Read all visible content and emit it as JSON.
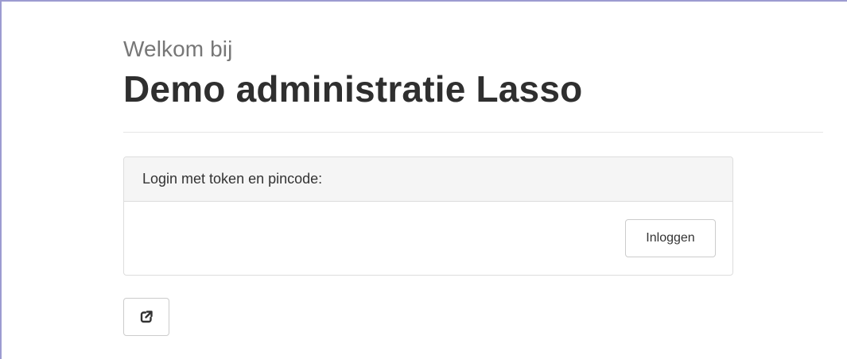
{
  "page": {
    "welcome": "Welkom bij",
    "title": "Demo administratie Lasso"
  },
  "login_panel": {
    "heading": "Login met token en pincode:",
    "login_button": "Inloggen"
  },
  "external_button": {
    "icon": "external-link-icon"
  },
  "colors": {
    "frame_border": "#9c9bd0",
    "panel_heading_bg": "#f5f5f5",
    "border": "#dddddd"
  }
}
